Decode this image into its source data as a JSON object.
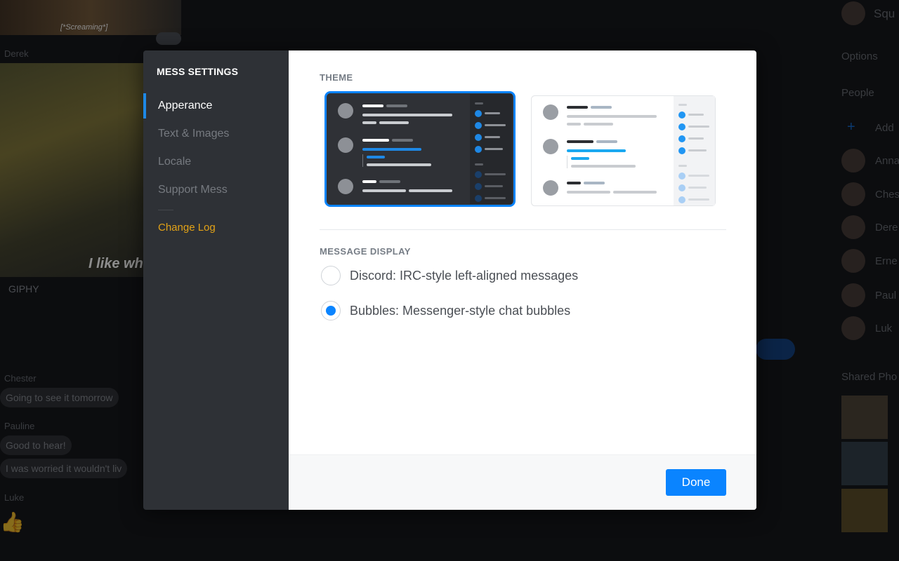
{
  "background": {
    "hero_caption": "[*Screaming*]",
    "names": [
      "Derek",
      "Chester",
      "Pauline",
      "Luke"
    ],
    "gif_caption": "I like wh",
    "giphy_label": "GIPHY",
    "messages": [
      "Going to see it tomorrow",
      "Good to hear!",
      "I was worried it wouldn't liv"
    ],
    "right_panel": {
      "title": "Squ",
      "options": "Options",
      "people": "People",
      "add": "Add",
      "members": [
        "Anna",
        "Ches",
        "Dere",
        "Erne",
        "Paul",
        "Luk"
      ],
      "shared": "Shared Pho"
    }
  },
  "modal": {
    "title": "MESS SETTINGS",
    "nav": [
      {
        "label": "Apperance",
        "active": true
      },
      {
        "label": "Text & Images",
        "active": false
      },
      {
        "label": "Locale",
        "active": false
      },
      {
        "label": "Support Mess",
        "active": false
      }
    ],
    "changelog": "Change Log",
    "theme_label": "THEME",
    "themes": [
      {
        "name": "dark",
        "selected": true
      },
      {
        "name": "light",
        "selected": false
      }
    ],
    "message_display_label": "MESSAGE DISPLAY",
    "options": [
      {
        "label": "Discord: IRC-style left-aligned messages",
        "selected": false
      },
      {
        "label": "Bubbles: Messenger-style chat bubbles",
        "selected": true
      }
    ],
    "done_label": "Done"
  },
  "colors": {
    "accent": "#0a84ff",
    "changelog": "#e2a217",
    "sidebar_bg": "#2e3136"
  }
}
